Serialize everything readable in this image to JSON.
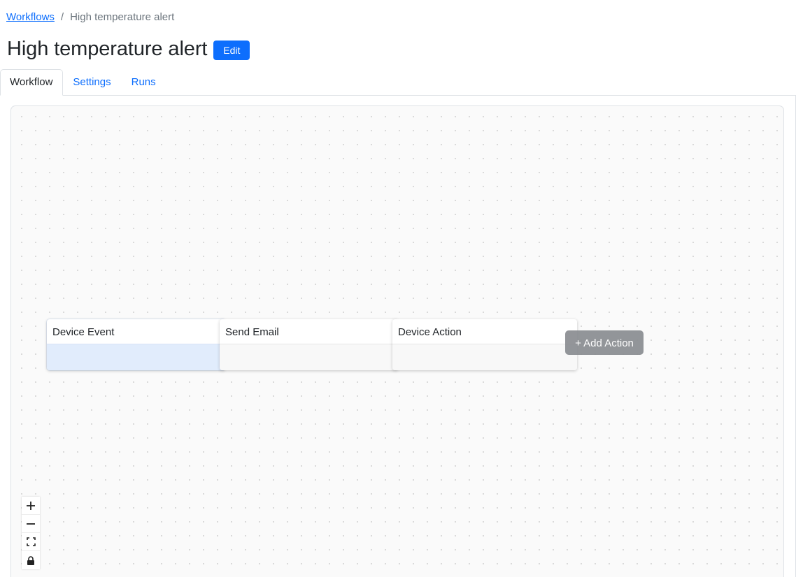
{
  "breadcrumb": {
    "parent_label": "Workflows",
    "separator": "/",
    "current_label": "High temperature alert"
  },
  "header": {
    "title": "High temperature alert",
    "edit_label": "Edit"
  },
  "tabs": [
    {
      "label": "Workflow",
      "active": true
    },
    {
      "label": "Settings",
      "active": false
    },
    {
      "label": "Runs",
      "active": false
    }
  ],
  "workflow": {
    "nodes": [
      {
        "title": "Device Event",
        "selected": true
      },
      {
        "title": "Send Email",
        "selected": false
      },
      {
        "title": "Device Action",
        "selected": false
      }
    ],
    "add_action_label": "+ Add Action"
  },
  "controls": {
    "icons": [
      "plus-icon",
      "minus-icon",
      "fit-view-icon",
      "lock-icon"
    ]
  },
  "colors": {
    "primary": "#0d6efd",
    "selected_node_body": "#e1ecfc",
    "add_action_bg": "#8a8d91"
  }
}
